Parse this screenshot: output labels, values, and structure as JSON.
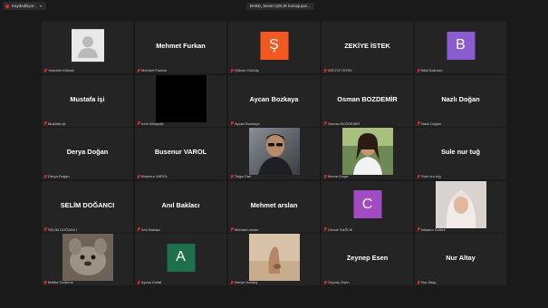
{
  "recording": {
    "label": "Kaydediliyor..."
  },
  "meeting": {
    "title": "BA6D_Sevim ÇELİK konuşuyor..."
  },
  "participants": [
    {
      "type": "default-avatar",
      "label": "Yasemin Köksal"
    },
    {
      "type": "name",
      "display": "Mehmet Furkan",
      "label": "Mehmet Furkan"
    },
    {
      "type": "letter",
      "letter": "Ş",
      "color": "#f2581f",
      "label": "Şükran Gümüş"
    },
    {
      "type": "name",
      "display": "ZEKİYE İSTEK",
      "label": "ZEKİYE İSTEK"
    },
    {
      "type": "letter",
      "letter": "B",
      "color": "#8a5cd0",
      "label": "Bilal Dalkıran"
    },
    {
      "type": "name",
      "display": "Mustafa işi",
      "label": "Mustafa İşi"
    },
    {
      "type": "black-video",
      "label": "İrem Albayrak"
    },
    {
      "type": "name",
      "display": "Aycan Bozkaya",
      "label": "Aycan Bozkaya"
    },
    {
      "type": "name",
      "display": "Osman BOZDEMİR",
      "label": "Osman BOZDEMİR"
    },
    {
      "type": "name",
      "display": "Nazlı Doğan",
      "label": "Nazlı Doğan"
    },
    {
      "type": "name",
      "display": "Derya Doğan",
      "label": "Derya Doğan"
    },
    {
      "type": "name",
      "display": "Busenur VAROL",
      "label": "Busenur VAROL"
    },
    {
      "type": "photo",
      "photo": "man-sunglasses",
      "label": "Tolga Gan"
    },
    {
      "type": "photo",
      "photo": "woman-outdoors",
      "label": "Merve Koşar"
    },
    {
      "type": "name",
      "display": "Sule nur tuğ",
      "label": "Sule nur tuğ"
    },
    {
      "type": "name",
      "display": "SELİM DOĞANCI",
      "label": "SELİM DOĞANCI"
    },
    {
      "type": "name",
      "display": "Anıl Baklacı",
      "label": "Anıl Baklacı"
    },
    {
      "type": "name",
      "display": "Mehmet arslan",
      "label": "Mehmet arslan"
    },
    {
      "type": "letter",
      "letter": "C",
      "color": "#a24bc2",
      "label": "Cende SAĞLIK"
    },
    {
      "type": "photo",
      "photo": "woman-hijab",
      "label": "Nisanur Öztürk"
    },
    {
      "type": "photo",
      "photo": "stuffed-animal",
      "label": "Melike Özdemir"
    },
    {
      "type": "letter",
      "letter": "A",
      "color": "#1f6e4c",
      "label": "Aycan Kollat"
    },
    {
      "type": "photo",
      "photo": "beige-hand",
      "label": "Neriye Kardaş"
    },
    {
      "type": "name",
      "display": "Zeynep Esen",
      "label": "Zeynep Esen"
    },
    {
      "type": "name",
      "display": "Nur Altay",
      "label": "Nur Altay"
    }
  ]
}
